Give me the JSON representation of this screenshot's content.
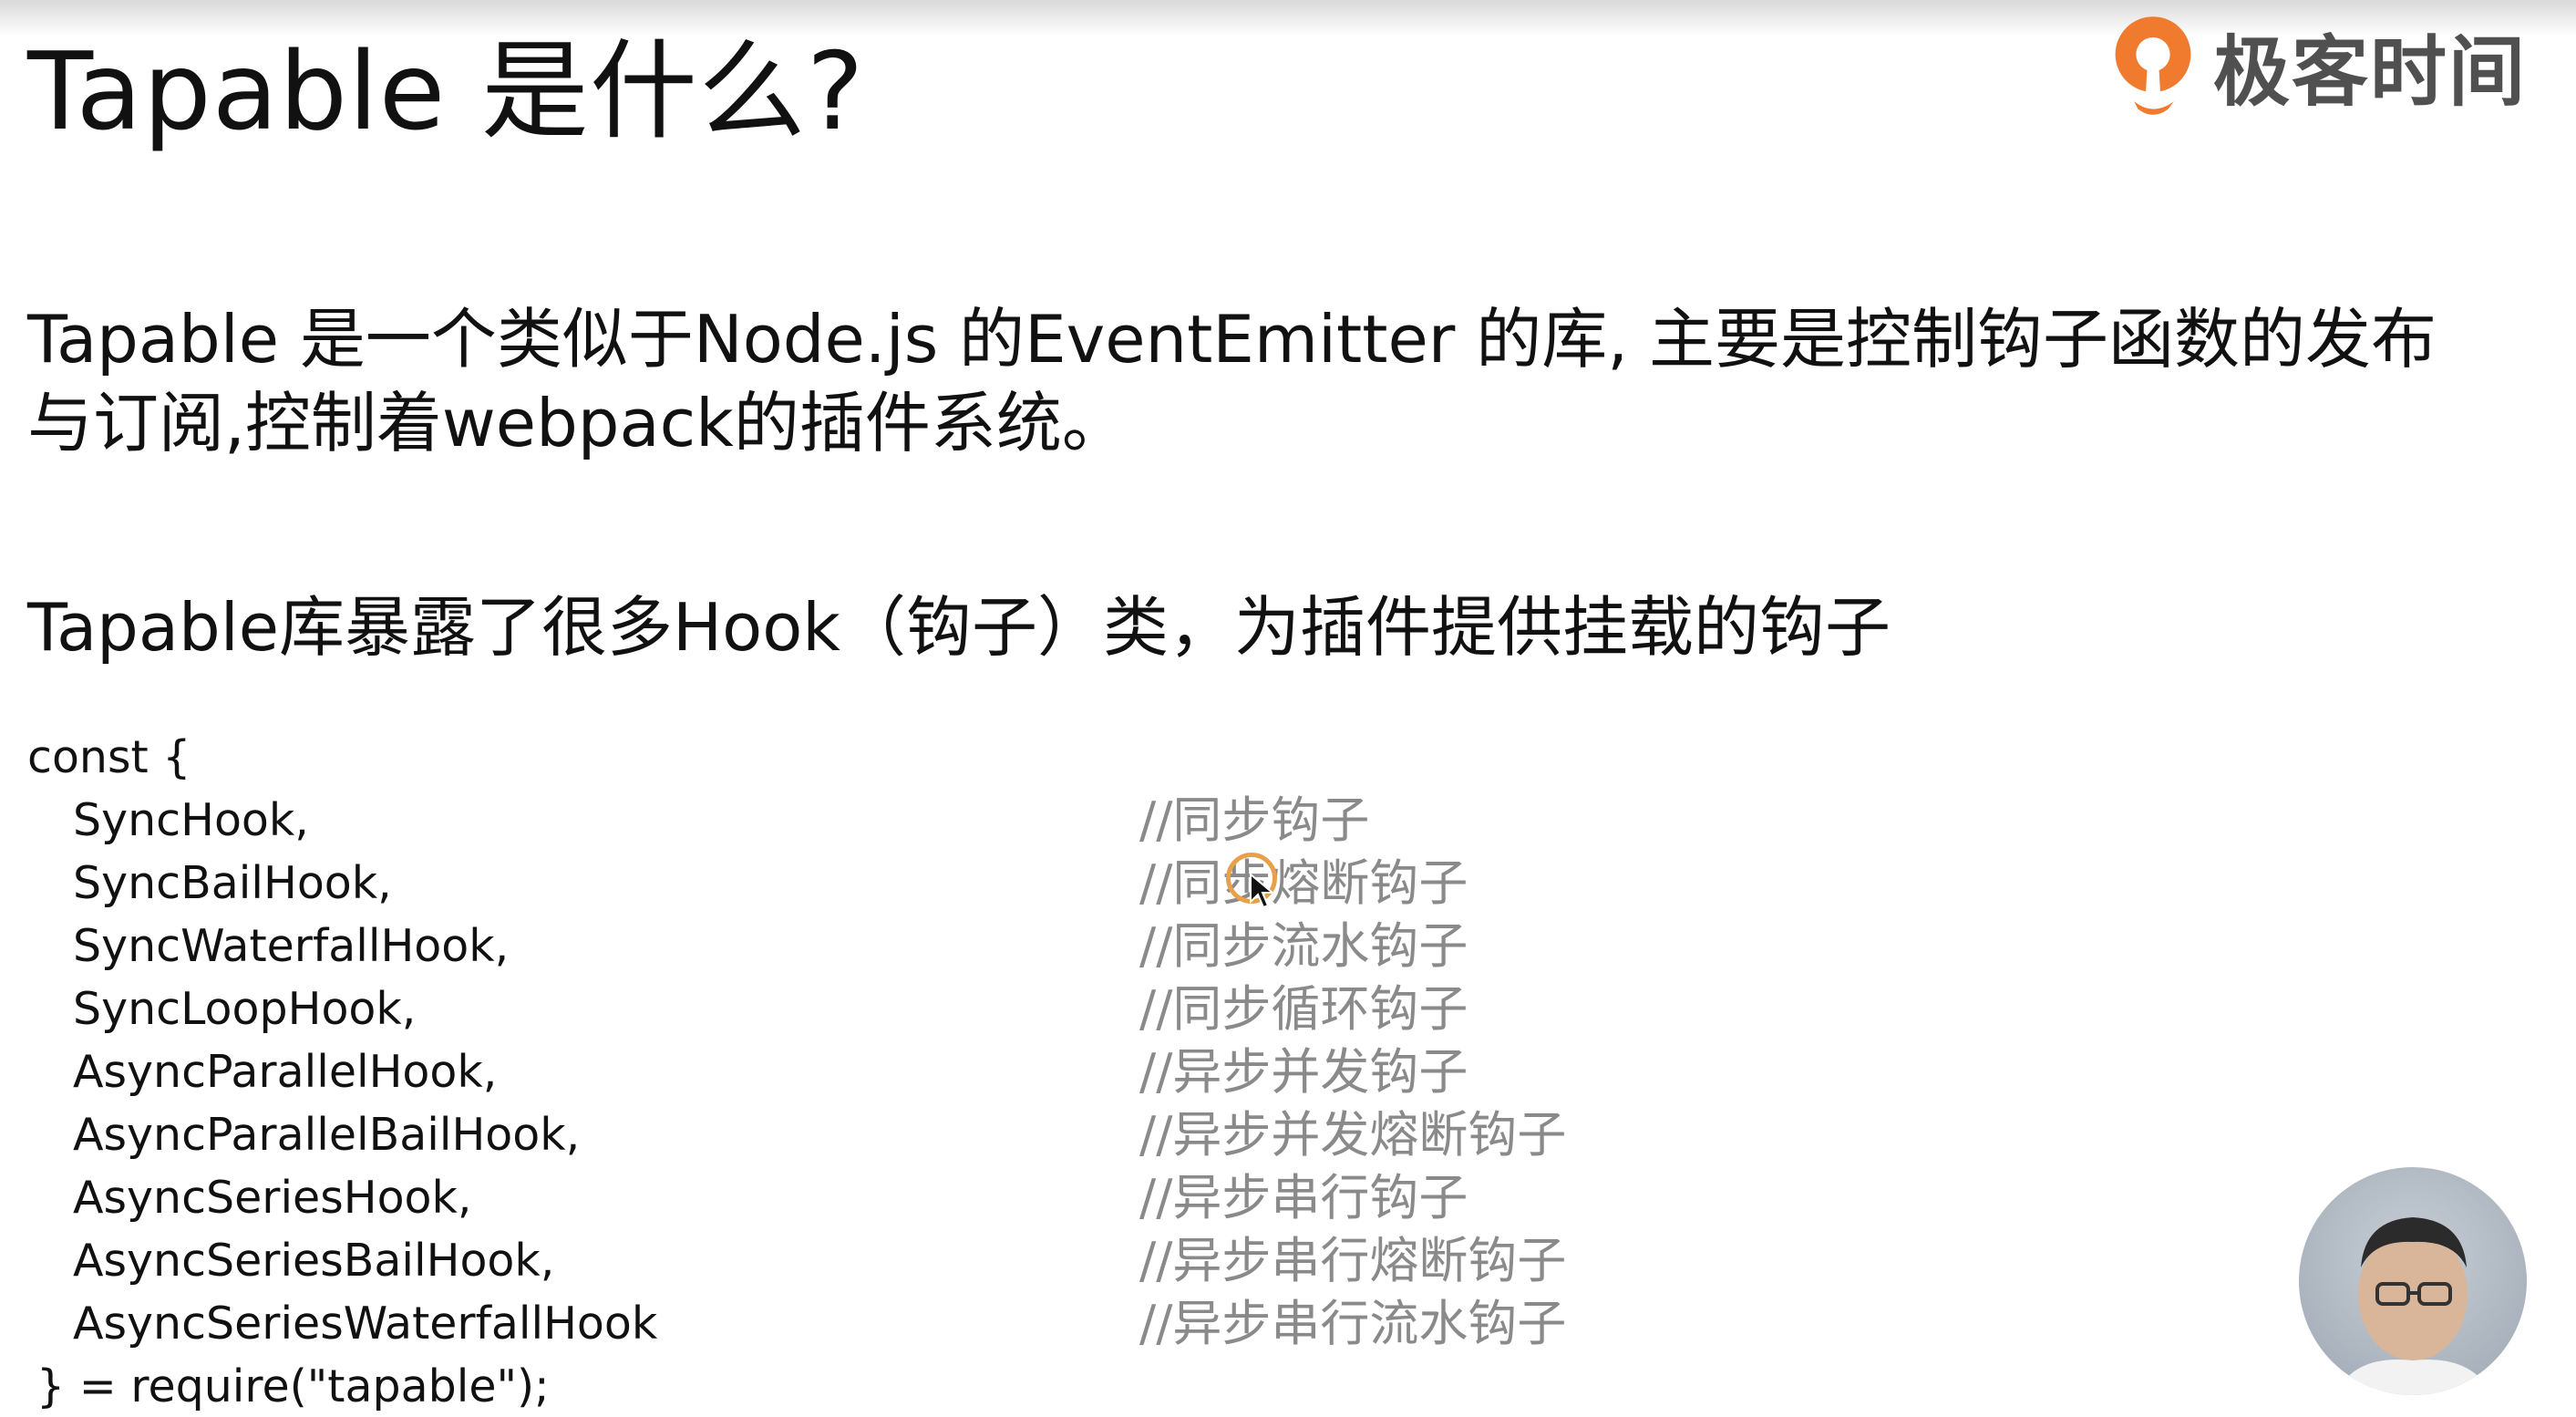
{
  "slide": {
    "title": "Tapable 是什么?",
    "paragraph1_line1": "Tapable 是一个类似于Node.js 的EventEmitter 的库, 主要是控制钩子函数的发布",
    "paragraph1_line2": "与订阅,控制着webpack的插件系统。",
    "paragraph2": "Tapable库暴露了很多Hook（钩子）类，为插件提供挂载的钩子"
  },
  "logo": {
    "text": "极客时间",
    "brand_color": "#f07a2e",
    "icon": "geektime-logo-icon"
  },
  "code": {
    "open": "const {",
    "close": "} = require(\"tapable\");",
    "items": [
      {
        "name": "SyncHook,",
        "comment": "//同步钩子"
      },
      {
        "name": "SyncBailHook,",
        "comment": "//同步熔断钩子"
      },
      {
        "name": "SyncWaterfallHook,",
        "comment": "//同步流水钩子"
      },
      {
        "name": "SyncLoopHook,",
        "comment": "//同步循环钩子"
      },
      {
        "name": "AsyncParallelHook,",
        "comment": "//异步并发钩子"
      },
      {
        "name": "AsyncParallelBailHook,",
        "comment": "//异步并发熔断钩子"
      },
      {
        "name": "AsyncSeriesHook,",
        "comment": "//异步串行钩子"
      },
      {
        "name": "AsyncSeriesBailHook,",
        "comment": "//异步串行熔断钩子"
      },
      {
        "name": "AsyncSeriesWaterfallHook",
        "comment": "//异步串行流水钩子"
      }
    ]
  },
  "overlay": {
    "cursor_icon": "mouse-pointer-icon",
    "cursor_ring_color": "#e8a04a",
    "presenter": "presenter-video-thumbnail"
  }
}
